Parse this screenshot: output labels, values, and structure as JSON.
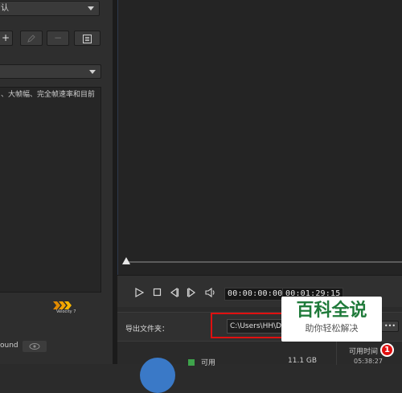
{
  "left": {
    "top_dropdown_text": "认",
    "second_dropdown_text": "",
    "description": "、大帧幅、完全帧速率和目前",
    "velocity_logo": "Velocity 7",
    "sound_label": "ound"
  },
  "transport": {
    "current_time": "00:00:00:00",
    "duration": "00:01:29:15"
  },
  "output": {
    "folder_label": "导出文件夹：",
    "path_value": "C:\\Users\\HH\\De",
    "more_label": "•••",
    "available_time_label": "可用时间",
    "available_time_value": "05:38:27",
    "disk_available_label": "可用",
    "disk_size": "11.1 GB"
  },
  "watermark": {
    "title": "百科全说",
    "subtitle": "助你轻松解决"
  },
  "annotation": {
    "badge_number": "1"
  },
  "colors": {
    "highlight_red": "#e01010",
    "disk_green": "#3ea34b",
    "disk_blue": "#3a79c7"
  }
}
